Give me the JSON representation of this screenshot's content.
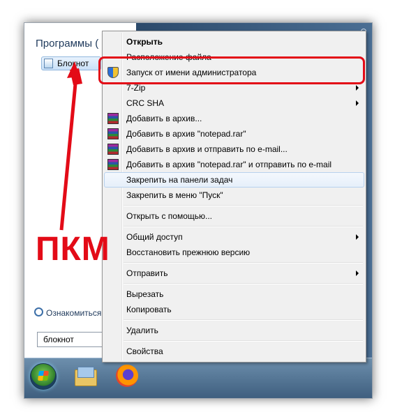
{
  "start_menu": {
    "programs_title": "Программы (",
    "program_item": "Блокнот",
    "see_more": "Ознакомиться",
    "search_value": "блокнот"
  },
  "context_menu": {
    "items": [
      {
        "label": "Открыть",
        "bold": true
      },
      {
        "label": "Расположение файла"
      },
      {
        "label": "Запуск от имени администратора",
        "icon": "uac-shield-icon"
      },
      {
        "label": "7-Zip",
        "submenu": true
      },
      {
        "label": "CRC SHA",
        "submenu": true
      },
      {
        "label": "Добавить в архив...",
        "icon": "winrar-icon"
      },
      {
        "label": "Добавить в архив \"notepad.rar\"",
        "icon": "winrar-icon"
      },
      {
        "label": "Добавить в архив и отправить по e-mail...",
        "icon": "winrar-icon"
      },
      {
        "label": "Добавить в архив \"notepad.rar\" и отправить по e-mail",
        "icon": "winrar-icon"
      },
      {
        "label": "Закрепить на панели задач",
        "highlighted": true
      },
      {
        "label": "Закрепить в меню \"Пуск\""
      },
      {
        "label": "Открыть с помощью..."
      },
      {
        "label": "Общий доступ",
        "submenu": true
      },
      {
        "label": "Восстановить прежнюю версию"
      },
      {
        "label": "Отправить",
        "submenu": true
      },
      {
        "label": "Вырезать"
      },
      {
        "label": "Копировать"
      },
      {
        "label": "Удалить"
      },
      {
        "label": "Свойства"
      }
    ]
  },
  "annotation": {
    "text": "ПКМ",
    "color": "#e30b17"
  },
  "taskbar": {
    "icons": [
      "start-orb-icon",
      "explorer-icon",
      "firefox-icon"
    ]
  }
}
